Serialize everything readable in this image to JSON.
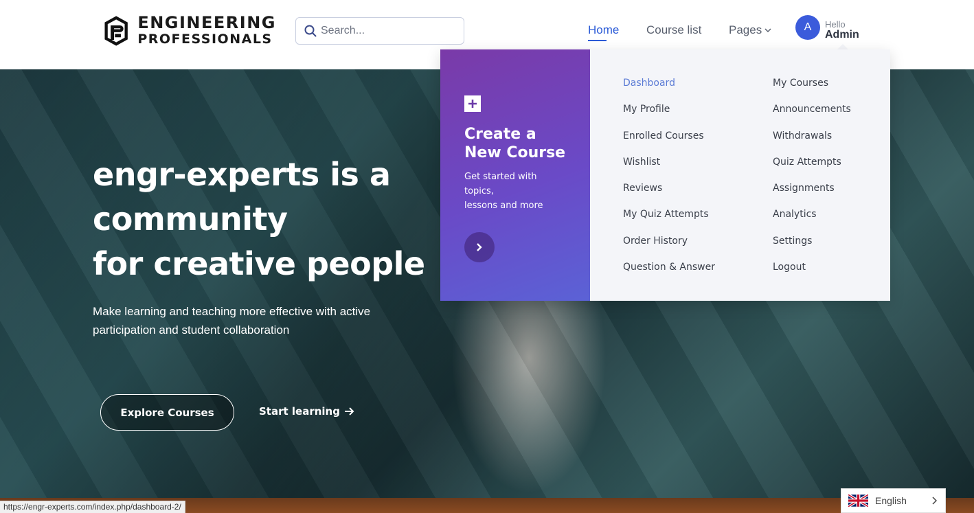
{
  "header": {
    "logo": {
      "line1": "ENGINEERING",
      "line2": "PROFESSIONALS"
    },
    "search": {
      "placeholder": "Search..."
    },
    "nav": {
      "home": "Home",
      "course_list": "Course list",
      "pages": "Pages"
    },
    "user": {
      "initial": "A",
      "greeting": "Hello",
      "name": "Admin"
    }
  },
  "hero": {
    "title_line1": "engr-experts is a",
    "title_line2": "community",
    "title_line3": "for creative people",
    "subtitle": "Make learning and teaching more effective with active participation and student collaboration",
    "explore_label": "Explore Courses",
    "start_label": "Start learning"
  },
  "dropdown": {
    "create": {
      "title_line1": "Create a",
      "title_line2": "New Course",
      "desc_line1": "Get started with topics,",
      "desc_line2": "lessons and more"
    },
    "col1": [
      "Dashboard",
      "My Profile",
      "Enrolled Courses",
      "Wishlist",
      "Reviews",
      "My Quiz Attempts",
      "Order History",
      "Question & Answer"
    ],
    "col2": [
      "My Courses",
      "Announcements",
      "Withdrawals",
      "Quiz Attempts",
      "Assignments",
      "Analytics",
      "Settings",
      "Logout"
    ],
    "active_item": "Dashboard"
  },
  "status_bar": {
    "url": "https://engr-experts.com/index.php/dashboard-2/"
  },
  "language": {
    "label": "English"
  },
  "colors": {
    "accent": "#2b5bd7",
    "panel_purple": "#6a4ac7",
    "avatar": "#3b5bdb"
  }
}
